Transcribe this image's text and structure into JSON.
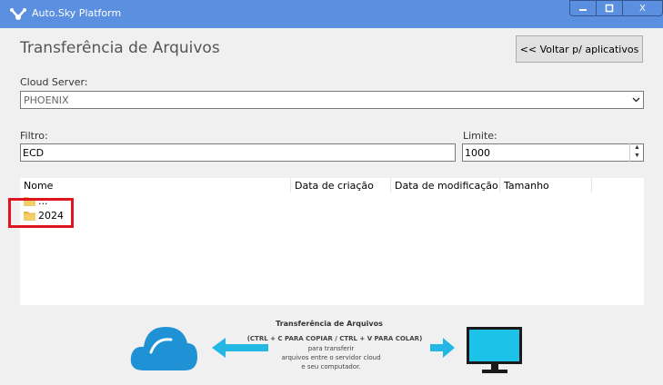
{
  "window": {
    "title": "Auto.Sky Platform",
    "controls": {
      "minimize": "—",
      "maximize": "□",
      "close": "X"
    }
  },
  "page": {
    "heading": "Transferência de Arquivos",
    "back_button": "<< Voltar p/ aplicativos"
  },
  "cloud_server": {
    "label": "Cloud Server:",
    "value": "PHOENIX"
  },
  "filter": {
    "label": "Filtro:",
    "value": "ECD"
  },
  "limit": {
    "label": "Limite:",
    "value": "1000"
  },
  "file_list": {
    "columns": [
      "Nome",
      "Data de criação",
      "Data de modificação",
      "Tamanho"
    ],
    "rows": [
      {
        "name": "...",
        "icon": "folder-icon"
      },
      {
        "name": "2024",
        "icon": "folder-icon"
      }
    ]
  },
  "banner": {
    "title": "Transferência de Arquivos",
    "shortcut": "(CTRL + C PARA COPIAR / CTRL + V PARA COLAR)",
    "line1": "para transferir",
    "line2": "arquivos entre o servidor cloud",
    "line3": "e seu computador."
  },
  "colors": {
    "titlebar": "#5b8fe0",
    "highlight": "#e0141e",
    "cloud": "#1f92d6",
    "arrow": "#23b7e5",
    "monitor_screen": "#1cc2e8"
  }
}
